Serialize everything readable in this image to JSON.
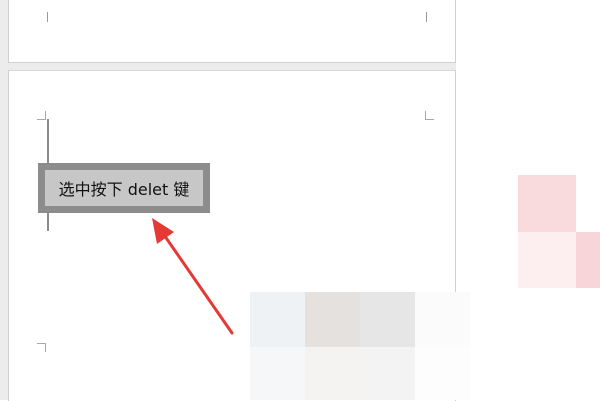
{
  "document": {
    "selected_text": "选中按下 delet 键"
  },
  "colors": {
    "annotation_arrow": "#e53935",
    "selection_highlight": "#c7c7c7",
    "selection_border": "#8c8c8c"
  }
}
